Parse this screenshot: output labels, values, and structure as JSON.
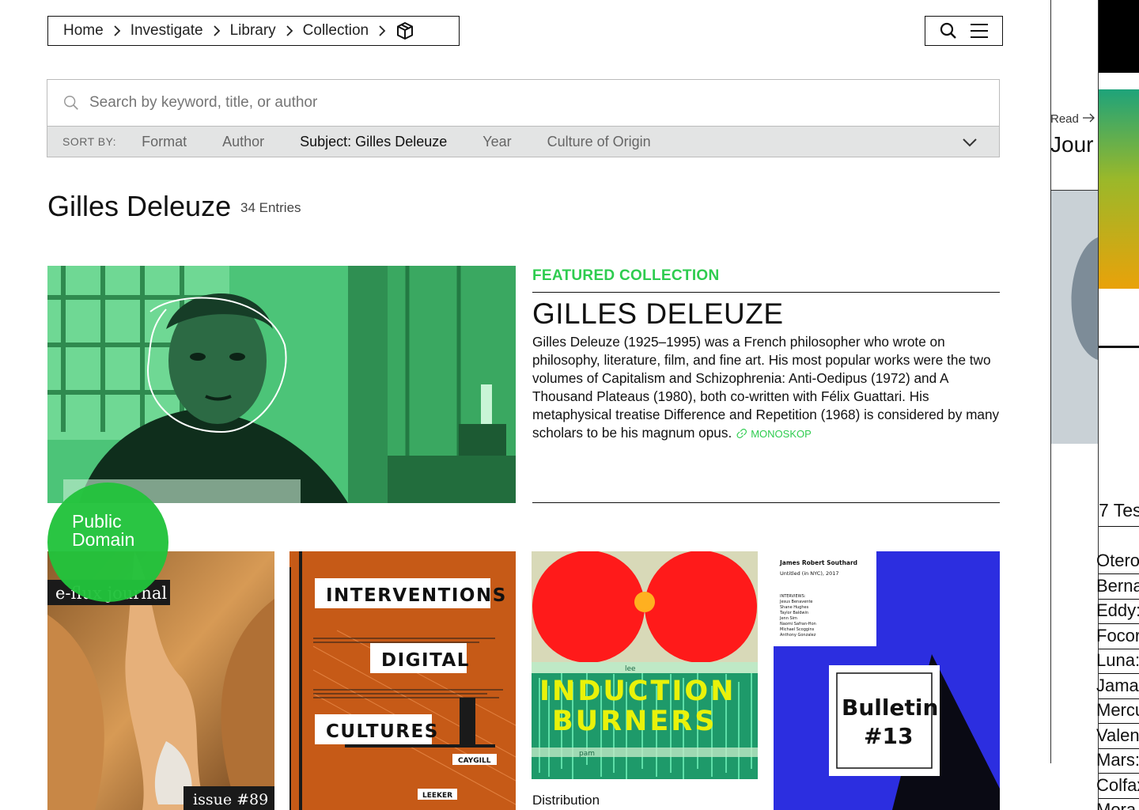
{
  "breadcrumb": {
    "items": [
      "Home",
      "Investigate",
      "Library",
      "Collection"
    ]
  },
  "search": {
    "placeholder": "Search by keyword, title, or author",
    "value": ""
  },
  "sort": {
    "label": "SORT BY:",
    "options": [
      "Format",
      "Author",
      "Subject: Gilles Deleuze",
      "Year",
      "Culture of Origin"
    ],
    "active": "Subject: Gilles Deleuze"
  },
  "page": {
    "title": "Gilles Deleuze",
    "entries": "34 Entries"
  },
  "featured": {
    "label": "FEATURED COLLECTION",
    "title": "GILLES DELEUZE",
    "description": "Gilles Deleuze (1925–1995) was a French philosopher who wrote on philosophy, literature, film, and fine art. His most popular works were the two volumes of Capitalism and Schizophrenia: Anti-Oedipus (1972) and A Thousand Plateaus (1980), both co-written with Félix Guattari. His metaphysical treatise Difference and Repetition (1968) is considered by many scholars to be his magnum opus.",
    "link_label": "MONOSKOP"
  },
  "badge": {
    "line1": "Public",
    "line2": "Domain"
  },
  "cards": {
    "c1": {
      "masthead": "e-flux journal",
      "issue": "issue #89"
    },
    "c2": {
      "w1": "INTERVENTIONS",
      "w2": "DIGITAL",
      "w3": "CULTURES",
      "author": "CAYGILL",
      "publisher": "LEEKER"
    },
    "c3": {
      "w1": "INDUCTION",
      "w2": "BURNERS",
      "tag1": "lee",
      "tag2": "pam",
      "caption": "Distribution"
    },
    "c4": {
      "author": "James Robert Southard",
      "work": "Untitled (in NYC), 2017",
      "list_head": "INTERVIEWS:",
      "names": [
        "Jesus Benavente",
        "Shane Hughes",
        "Taylor Baldwin",
        "Jenn Sim",
        "Naomi Safran-Hon",
        "Michael Scoggins",
        "Anthony Gonzalez"
      ],
      "b1": "Bulletin",
      "b2": "#13"
    }
  },
  "right_strip": {
    "read_label": "Read",
    "title_fragment": "Jour",
    "list_head": "7 Tes",
    "list": [
      "Otero",
      "Berna",
      "Eddy:",
      "Focor",
      "Luna:",
      "Jamal",
      "Mercu",
      "Valen",
      "Mars:",
      "Colfax",
      "Mora"
    ]
  },
  "colors": {
    "accent": "#2ecc4f",
    "badge": "#22c33c",
    "sortbar": "#e3e4e4",
    "bulletin_blue": "#2c2ee0",
    "card2_orange": "#c65a17"
  },
  "icons": [
    "chevron-right-icon",
    "package-icon",
    "search-icon",
    "menu-icon",
    "chevron-down-icon",
    "link-icon",
    "arrow-right-icon"
  ]
}
